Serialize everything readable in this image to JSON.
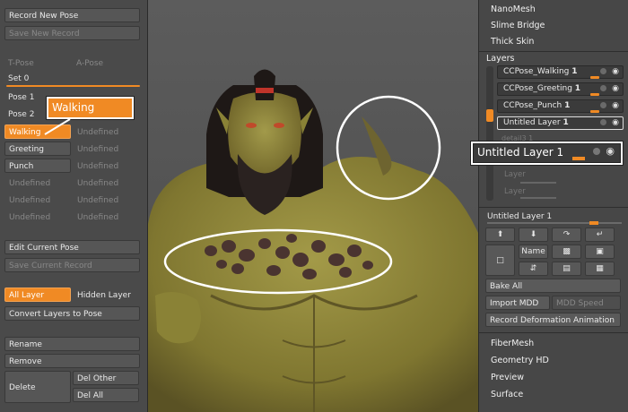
{
  "left_panel": {
    "record_new_pose": "Record New Pose",
    "save_new_record": "Save New Record",
    "t_pose": "T-Pose",
    "a_pose": "A-Pose",
    "set_label": "Set 0",
    "pose1": "Pose 1",
    "pose2": "Pose 2",
    "walking_tooltip": "Walking",
    "rows": [
      {
        "left": "Walking",
        "right": "Undefined"
      },
      {
        "left": "Greeting",
        "right": "Undefined"
      },
      {
        "left": "Punch",
        "right": "Undefined"
      },
      {
        "left": "Undefined",
        "right": "Undefined"
      },
      {
        "left": "Undefined",
        "right": "Undefined"
      },
      {
        "left": "Undefined",
        "right": "Undefined"
      }
    ],
    "edit_current_pose": "Edit Current Pose",
    "save_current_record": "Save Current Record",
    "all_layer": "All Layer",
    "hidden_layer": "Hidden Layer",
    "convert_layers": "Convert Layers to Pose",
    "rename": "Rename",
    "remove": "Remove",
    "delete": "Delete",
    "del_other": "Del Other",
    "del_all": "Del All"
  },
  "right_panel": {
    "top_menu": [
      "NanoMesh",
      "Slime Bridge",
      "Thick Skin"
    ],
    "layers_title": "Layers",
    "layers": [
      {
        "name": "CCPose_Walking",
        "num": "1"
      },
      {
        "name": "CCPose_Greeting",
        "num": "1"
      },
      {
        "name": "CCPose_Punch",
        "num": "1"
      },
      {
        "name": "Untitled Layer",
        "num": "1"
      }
    ],
    "callout_layer": "Untitled Layer 1",
    "partial_layer": "detail3 1",
    "layer_slider": "Layer",
    "layer_slider2": "Layer",
    "current_layer": "Untitled Layer 1",
    "name_button": "Name",
    "bake_all": "Bake All",
    "import_mdd": "Import MDD",
    "mdd_speed": "MDD Speed",
    "record_deformation": "Record Deformation Animation",
    "bottom_menu": [
      "FiberMesh",
      "Geometry HD",
      "Preview",
      "Surface"
    ]
  },
  "colors": {
    "accent": "#f08a24",
    "panel": "#4a4a4a",
    "skin": "#8a8a3a"
  }
}
